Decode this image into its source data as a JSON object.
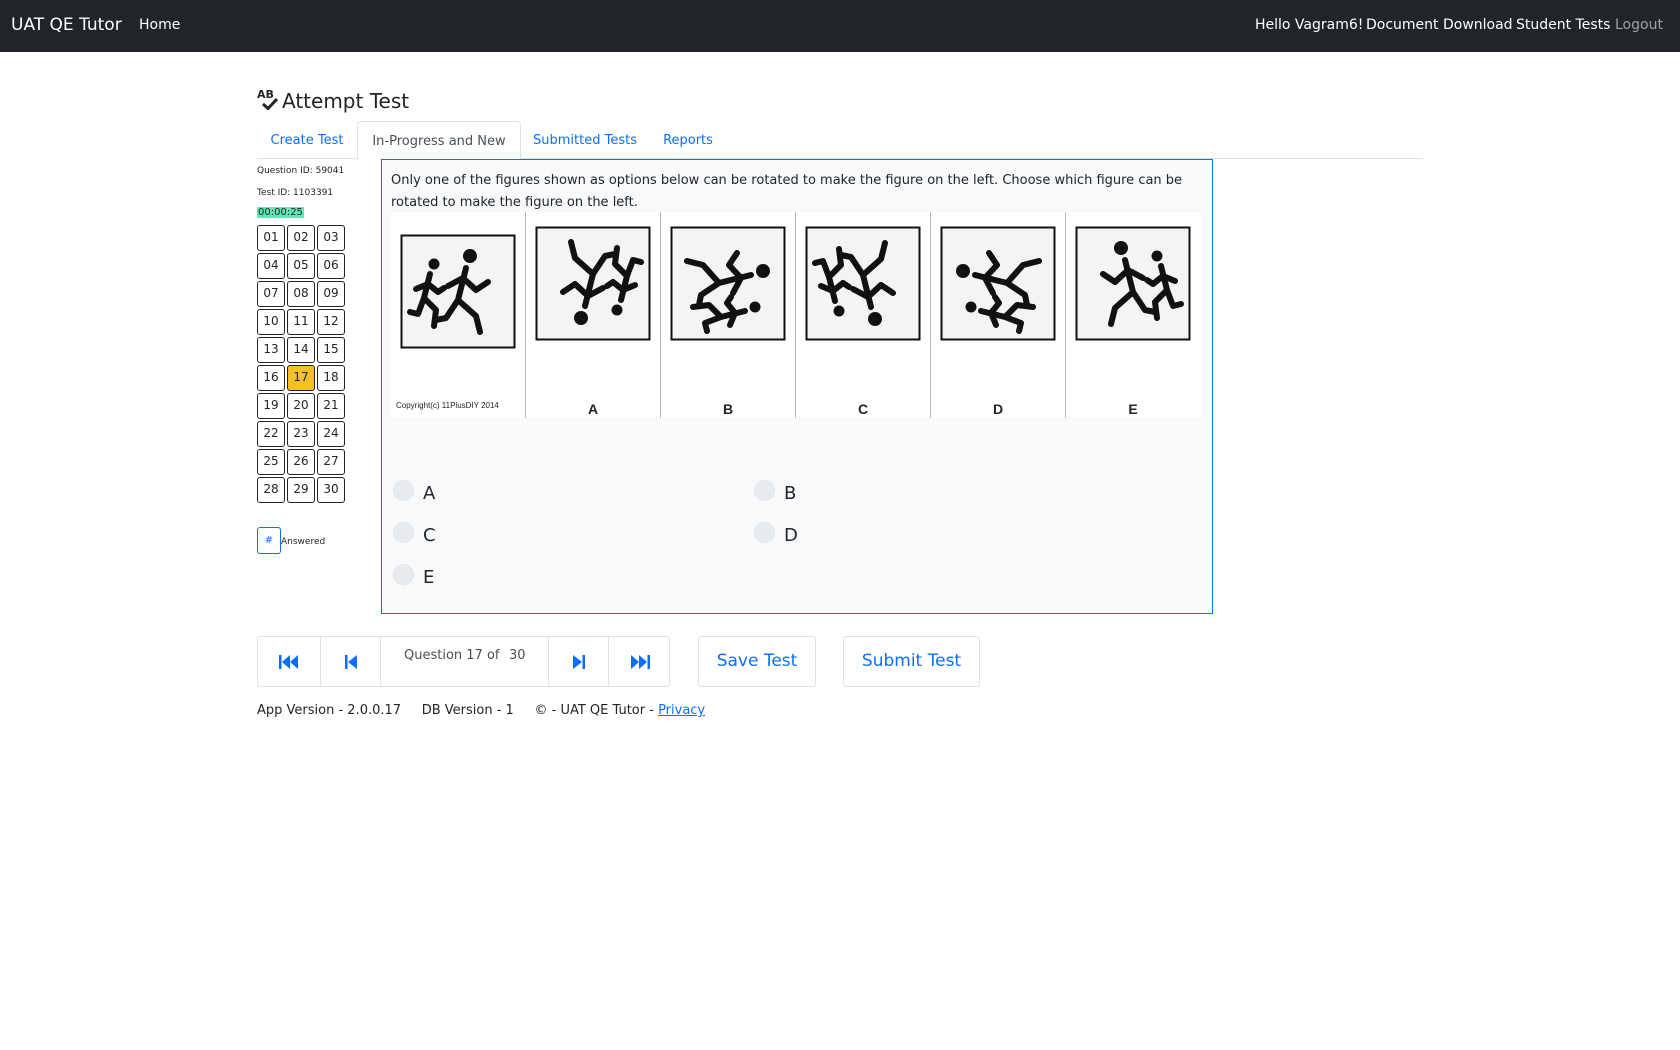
{
  "navbar": {
    "brand": "UAT QE Tutor",
    "home": "Home",
    "hello": "Hello Vagram6!",
    "document_download": "Document Download",
    "student_tests": "Student Tests",
    "logout": "Logout"
  },
  "page": {
    "title_icon_text": "AB",
    "title": "Attempt Test"
  },
  "tabs": [
    {
      "label": "Create Test"
    },
    {
      "label": "In-Progress and New",
      "active": true
    },
    {
      "label": "Submitted Tests"
    },
    {
      "label": "Reports"
    }
  ],
  "sidebar": {
    "question_id": "Question ID: 59041",
    "test_id": "Test ID: 1103391",
    "timer": "00:00:25",
    "questions": [
      "01",
      "02",
      "03",
      "04",
      "05",
      "06",
      "07",
      "08",
      "09",
      "10",
      "11",
      "12",
      "13",
      "14",
      "15",
      "16",
      "17",
      "18",
      "19",
      "20",
      "21",
      "22",
      "23",
      "24",
      "25",
      "26",
      "27",
      "28",
      "29",
      "30"
    ],
    "current_question": "17",
    "legend_symbol": "#",
    "legend_label": "Answered"
  },
  "question": {
    "text": "Only one of the figures shown as options below can be rotated to make the figure on the left. Choose which figure can be rotated to make the figure on the left.",
    "figure_copyright": "Copyright(c) 11PlusDIY 2014",
    "figure_labels": [
      "A",
      "B",
      "C",
      "D",
      "E"
    ],
    "options": [
      "A",
      "B",
      "C",
      "D",
      "E"
    ]
  },
  "navigation": {
    "counter_prefix": "Question 17 of",
    "counter_total": "30",
    "save_label": "Save Test",
    "submit_label": "Submit Test"
  },
  "footer": {
    "app_version": "App Version - 2.0.0.17",
    "db_version": "DB Version - 1",
    "copyright": "© - UAT QE Tutor -",
    "privacy": "Privacy"
  },
  "colors": {
    "navbar": "#212529",
    "accent": "#0d6efd",
    "current_question": "#f5bf26",
    "timer": "#5de8b4"
  }
}
